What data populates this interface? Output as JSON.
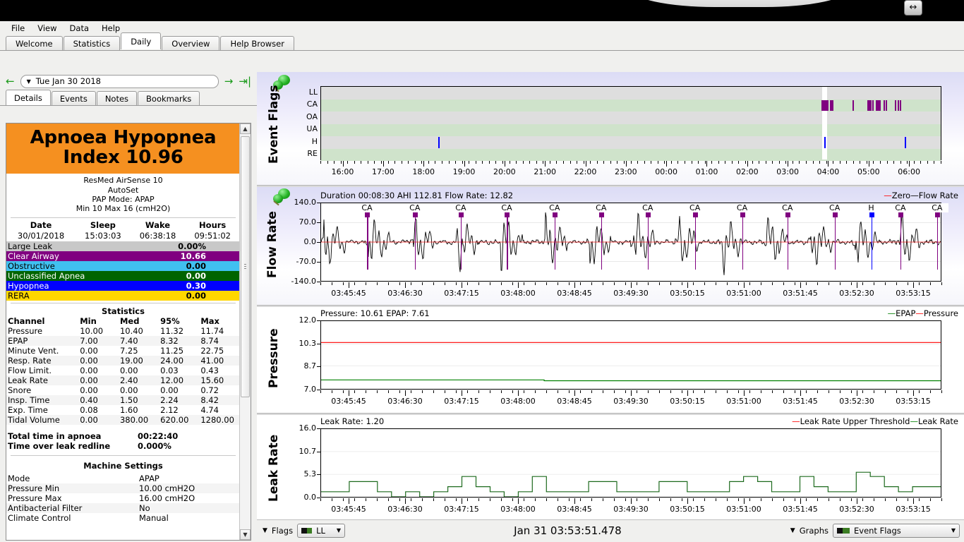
{
  "window": {
    "resize_icon": "resize-horizontal-icon"
  },
  "menubar": {
    "items": [
      "File",
      "View",
      "Data",
      "Help"
    ]
  },
  "tabs": {
    "items": [
      "Welcome",
      "Statistics",
      "Daily",
      "Overview",
      "Help Browser"
    ],
    "active": "Daily"
  },
  "datenav": {
    "prev_icon": "arrow-left-icon",
    "dropdown_icon": "chevron-down-icon",
    "date": "Tue Jan 30 2018",
    "next_icon": "arrow-right-icon",
    "last_icon": "arrow-to-end-icon"
  },
  "subtabs": {
    "items": [
      "Details",
      "Events",
      "Notes",
      "Bookmarks"
    ],
    "active": "Details"
  },
  "details": {
    "ahi_title_line1": "Apnoea Hypopnea",
    "ahi_title_line2": "Index 10.96",
    "ahi_bg": "#f59020",
    "device": [
      "ResMed AirSense 10",
      "AutoSet",
      "PAP Mode: APAP",
      "Min 10 Max 16 (cmH2O)"
    ],
    "session": {
      "headers": [
        "Date",
        "Sleep",
        "Wake",
        "Hours"
      ],
      "values": [
        "30/01/2018",
        "15:03:03",
        "06:38:18",
        "09:51:02"
      ]
    },
    "events": [
      {
        "label": "Large Leak",
        "value": "0.00%",
        "bg": "#c8c8c8",
        "fg": "#000000"
      },
      {
        "label": "Clear Airway",
        "value": "10.66",
        "bg": "#800080",
        "fg": "#ffffff"
      },
      {
        "label": "Obstructive",
        "value": "0.00",
        "bg": "#40c0f0",
        "fg": "#000000"
      },
      {
        "label": "Unclassified Apnea",
        "value": "0.00",
        "bg": "#006400",
        "fg": "#ffffff"
      },
      {
        "label": "Hypopnea",
        "value": "0.30",
        "bg": "#0000ff",
        "fg": "#ffffff"
      },
      {
        "label": "RERA",
        "value": "0.00",
        "bg": "#ffd700",
        "fg": "#000000"
      }
    ],
    "statistics": {
      "title": "Statistics",
      "headers": [
        "Channel",
        "Min",
        "Med",
        "95%",
        "Max"
      ],
      "rows": [
        [
          "Pressure",
          "10.00",
          "10.40",
          "11.32",
          "11.74"
        ],
        [
          "EPAP",
          "7.00",
          "7.40",
          "8.32",
          "8.74"
        ],
        [
          "Minute Vent.",
          "0.00",
          "7.25",
          "11.25",
          "22.75"
        ],
        [
          "Resp. Rate",
          "0.00",
          "19.00",
          "24.00",
          "41.00"
        ],
        [
          "Flow Limit.",
          "0.00",
          "0.00",
          "0.03",
          "0.43"
        ],
        [
          "Leak Rate",
          "0.00",
          "2.40",
          "12.00",
          "15.60"
        ],
        [
          "Snore",
          "0.00",
          "0.00",
          "0.00",
          "0.72"
        ],
        [
          "Insp. Time",
          "0.40",
          "1.50",
          "2.24",
          "8.42"
        ],
        [
          "Exp. Time",
          "0.08",
          "1.60",
          "2.12",
          "4.74"
        ],
        [
          "Tidal Volume",
          "0.00",
          "380.00",
          "620.00",
          "1280.00"
        ]
      ],
      "totals": [
        {
          "label": "Total time in apnoea",
          "value": "00:22:40"
        },
        {
          "label": "Time over leak redline",
          "value": "0.000%"
        }
      ]
    },
    "machine_settings": {
      "title": "Machine Settings",
      "rows": [
        [
          "Mode",
          "APAP"
        ],
        [
          "Pressure Min",
          "10.00 cmH2O"
        ],
        [
          "Pressure Max",
          "16.00 cmH2O"
        ],
        [
          "Antibacterial Filter",
          "No"
        ],
        [
          "Climate Control",
          "Manual"
        ]
      ]
    }
  },
  "chart_data": [
    {
      "type": "heatmap",
      "name": "event-flags",
      "title": "Event Flags",
      "pin_icon": "pushpin-icon",
      "categories": [
        "LL",
        "CA",
        "OA",
        "UA",
        "H",
        "RE"
      ],
      "row_colors": [
        "#dedede",
        "#cfe3cb",
        "#dedede",
        "#cfe3cb",
        "#dedede",
        "#cfe3cb"
      ],
      "xlabel": "",
      "x_ticks": [
        "16:00",
        "17:00",
        "18:00",
        "19:00",
        "20:00",
        "21:00",
        "22:00",
        "23:00",
        "00:00",
        "01:00",
        "02:00",
        "03:00",
        "04:00",
        "05:00",
        "06:00"
      ],
      "x_range_hours": [
        15.45,
        6.8
      ],
      "series": [
        {
          "name": "CA",
          "color": "#800080",
          "row": "CA",
          "marks": [
            {
              "start": 3.82,
              "width": 0.17
            },
            {
              "start": 4.03,
              "width": 0.08
            },
            {
              "start": 4.58,
              "width": 0.018
            },
            {
              "start": 4.95,
              "width": 0.1
            },
            {
              "start": 5.08,
              "width": 0.02
            },
            {
              "start": 5.16,
              "width": 0.12
            },
            {
              "start": 5.36,
              "width": 0.018
            },
            {
              "start": 5.4,
              "width": 0.018
            },
            {
              "start": 5.63,
              "width": 0.018
            },
            {
              "start": 5.7,
              "width": 0.018
            },
            {
              "start": 5.76,
              "width": 0.018
            }
          ]
        },
        {
          "name": "H",
          "color": "#0000ff",
          "row": "H",
          "marks": [
            {
              "start": 18.35,
              "width": 0.012
            },
            {
              "start": 3.89,
              "width": 0.012
            },
            {
              "start": 5.87,
              "width": 0.012
            }
          ]
        }
      ],
      "cursor": {
        "position": 3.885,
        "color": "#ffffff"
      }
    },
    {
      "type": "line",
      "name": "flow-rate",
      "title": "Flow Rate",
      "pin_icon": "pushpin-icon",
      "header": "Duration 00:08:30 AHI 112.81 Flow Rate: 12.82",
      "legend": [
        "Zero",
        "Flow Rate"
      ],
      "legend_colors": [
        "#ff0000",
        "#000000"
      ],
      "ylabel": "Flow Rate",
      "y_ticks": [
        "140.0",
        "70.0",
        "0.0",
        "-70.0",
        "-140.0"
      ],
      "ylim": [
        -140,
        140
      ],
      "zero_line": 0,
      "x_ticks": [
        "03:45:45",
        "03:46:30",
        "03:47:15",
        "03:48:00",
        "03:48:45",
        "03:49:30",
        "03:50:15",
        "03:51:00",
        "03:51:45",
        "03:52:30",
        "03:53:15"
      ],
      "event_markers": [
        {
          "label": "CA",
          "x": 0.075,
          "color": "#800080"
        },
        {
          "label": "CA",
          "x": 0.152,
          "color": "#800080"
        },
        {
          "label": "CA",
          "x": 0.226,
          "color": "#800080"
        },
        {
          "label": "CA",
          "x": 0.3,
          "color": "#800080"
        },
        {
          "label": "CA",
          "x": 0.377,
          "color": "#800080"
        },
        {
          "label": "CA",
          "x": 0.452,
          "color": "#800080"
        },
        {
          "label": "CA",
          "x": 0.527,
          "color": "#800080"
        },
        {
          "label": "CA",
          "x": 0.603,
          "color": "#800080"
        },
        {
          "label": "CA",
          "x": 0.679,
          "color": "#800080"
        },
        {
          "label": "CA",
          "x": 0.752,
          "color": "#800080"
        },
        {
          "label": "CA",
          "x": 0.828,
          "color": "#800080"
        },
        {
          "label": "H",
          "x": 0.887,
          "color": "#0000ff"
        },
        {
          "label": "CA",
          "x": 0.934,
          "color": "#800080"
        },
        {
          "label": "CA",
          "x": 0.993,
          "color": "#800080"
        }
      ]
    },
    {
      "type": "line",
      "name": "pressure",
      "title": "Pressure",
      "header": "Pressure: 10.61 EPAP: 7.61",
      "legend": [
        "EPAP",
        "Pressure"
      ],
      "legend_colors": [
        "#008000",
        "#ff0000"
      ],
      "ylabel": "Pressure",
      "y_ticks": [
        "12.0",
        "10.3",
        "8.7",
        "7.0"
      ],
      "ylim": [
        7.0,
        12.0
      ],
      "x_ticks": [
        "03:45:45",
        "03:46:30",
        "03:47:15",
        "03:48:00",
        "03:48:45",
        "03:49:30",
        "03:50:15",
        "03:51:00",
        "03:51:45",
        "03:52:30",
        "03:53:15"
      ],
      "series": [
        {
          "name": "Pressure",
          "color": "#ff0000",
          "value": 10.42
        },
        {
          "name": "EPAP",
          "color": "#008000",
          "value": 7.62
        }
      ]
    },
    {
      "type": "line",
      "name": "leak-rate",
      "title": "Leak Rate",
      "header": "Leak Rate: 1.20",
      "legend": [
        "Leak Rate Upper Threshold",
        "Leak Rate"
      ],
      "legend_colors": [
        "#ff0000",
        "#008000"
      ],
      "ylabel": "Leak Rate",
      "y_ticks": [
        "16.0",
        "10.7",
        "5.3",
        "0.0"
      ],
      "ylim": [
        0,
        16
      ],
      "x_ticks": [
        "03:45:45",
        "03:46:30",
        "03:47:15",
        "03:48:00",
        "03:48:45",
        "03:49:30",
        "03:50:15",
        "03:51:00",
        "03:51:45",
        "03:52:30",
        "03:53:15"
      ],
      "series": [
        {
          "name": "Leak Rate",
          "color": "#1d6a1d",
          "values": [
            1.2,
            1.2,
            3.6,
            3.6,
            1.2,
            0.0,
            1.2,
            0.0,
            1.2,
            2.4,
            4.8,
            2.4,
            1.2,
            0.0,
            1.2,
            4.8,
            1.2,
            1.2,
            1.2,
            3.6,
            3.6,
            1.2,
            1.2,
            1.2,
            3.6,
            3.6,
            1.2,
            1.2,
            1.2,
            3.6,
            4.8,
            3.6,
            1.2,
            1.2,
            4.8,
            2.4,
            1.2,
            1.2,
            5.8,
            4.8,
            2.4,
            1.2,
            2.4,
            2.4
          ]
        }
      ]
    }
  ],
  "bottombar": {
    "flags_caret": "chevron-down-icon",
    "flags_label": "Flags",
    "flags_value": "LL",
    "timestamp": "Jan 31 03:53:51.478",
    "graphs_caret": "chevron-down-icon",
    "graphs_label": "Graphs",
    "graphs_value": "Event Flags"
  }
}
